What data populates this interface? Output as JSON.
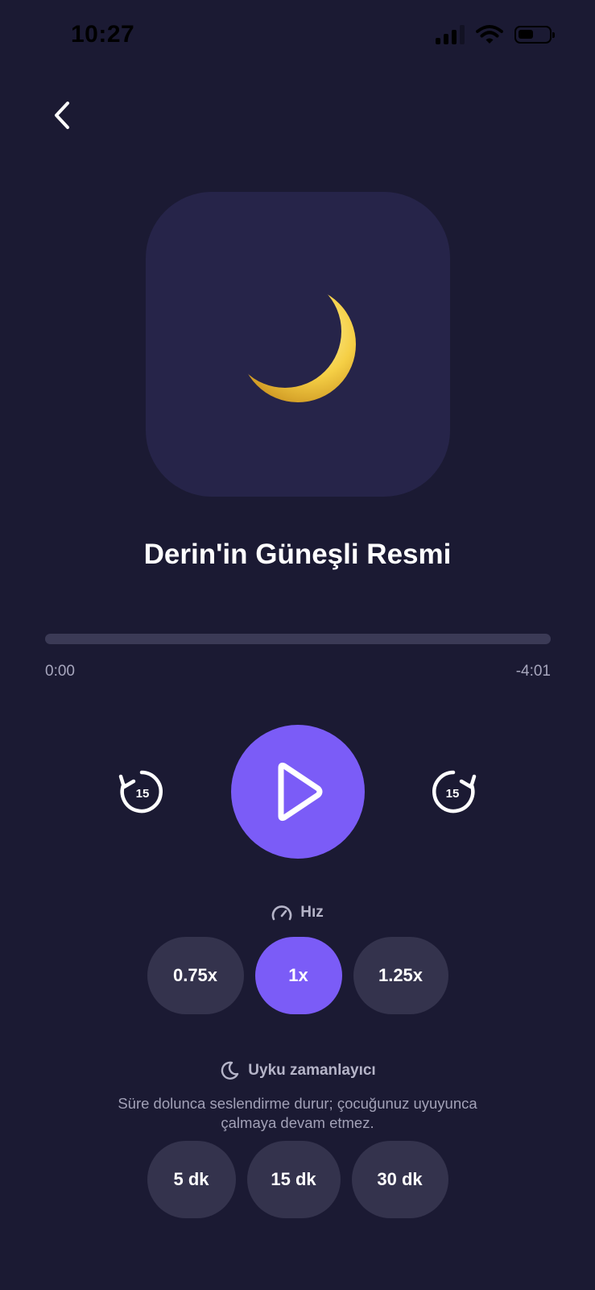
{
  "status_bar": {
    "time": "10:27"
  },
  "icons": {
    "back": "chevron-left-icon",
    "artwork": "crescent-moon-icon",
    "skip_back": "rewind-15-icon",
    "skip_forward": "forward-15-icon",
    "play": "play-icon",
    "speed": "speedometer-icon",
    "sleep": "moon-icon"
  },
  "colors": {
    "background": "#1b1a33",
    "accent": "#7b5cf7",
    "pill": "#34334d",
    "artwork_bg": "#262449"
  },
  "track": {
    "title": "Derin'in Güneşli Resmi",
    "elapsed": "0:00",
    "remaining": "-4:01",
    "progress": 0
  },
  "controls": {
    "skip_back_label": "15",
    "skip_forward_label": "15"
  },
  "speed": {
    "label": "Hız",
    "options": [
      "0.75x",
      "1x",
      "1.25x"
    ],
    "selected": "1x"
  },
  "sleep_timer": {
    "label": "Uyku zamanlayıcı",
    "description_line1": "Süre dolunca seslendirme durur; çocuğunuz uyuyunca",
    "description_line2": "çalmaya devam etmez.",
    "options": [
      "5 dk",
      "15 dk",
      "30 dk"
    ]
  }
}
